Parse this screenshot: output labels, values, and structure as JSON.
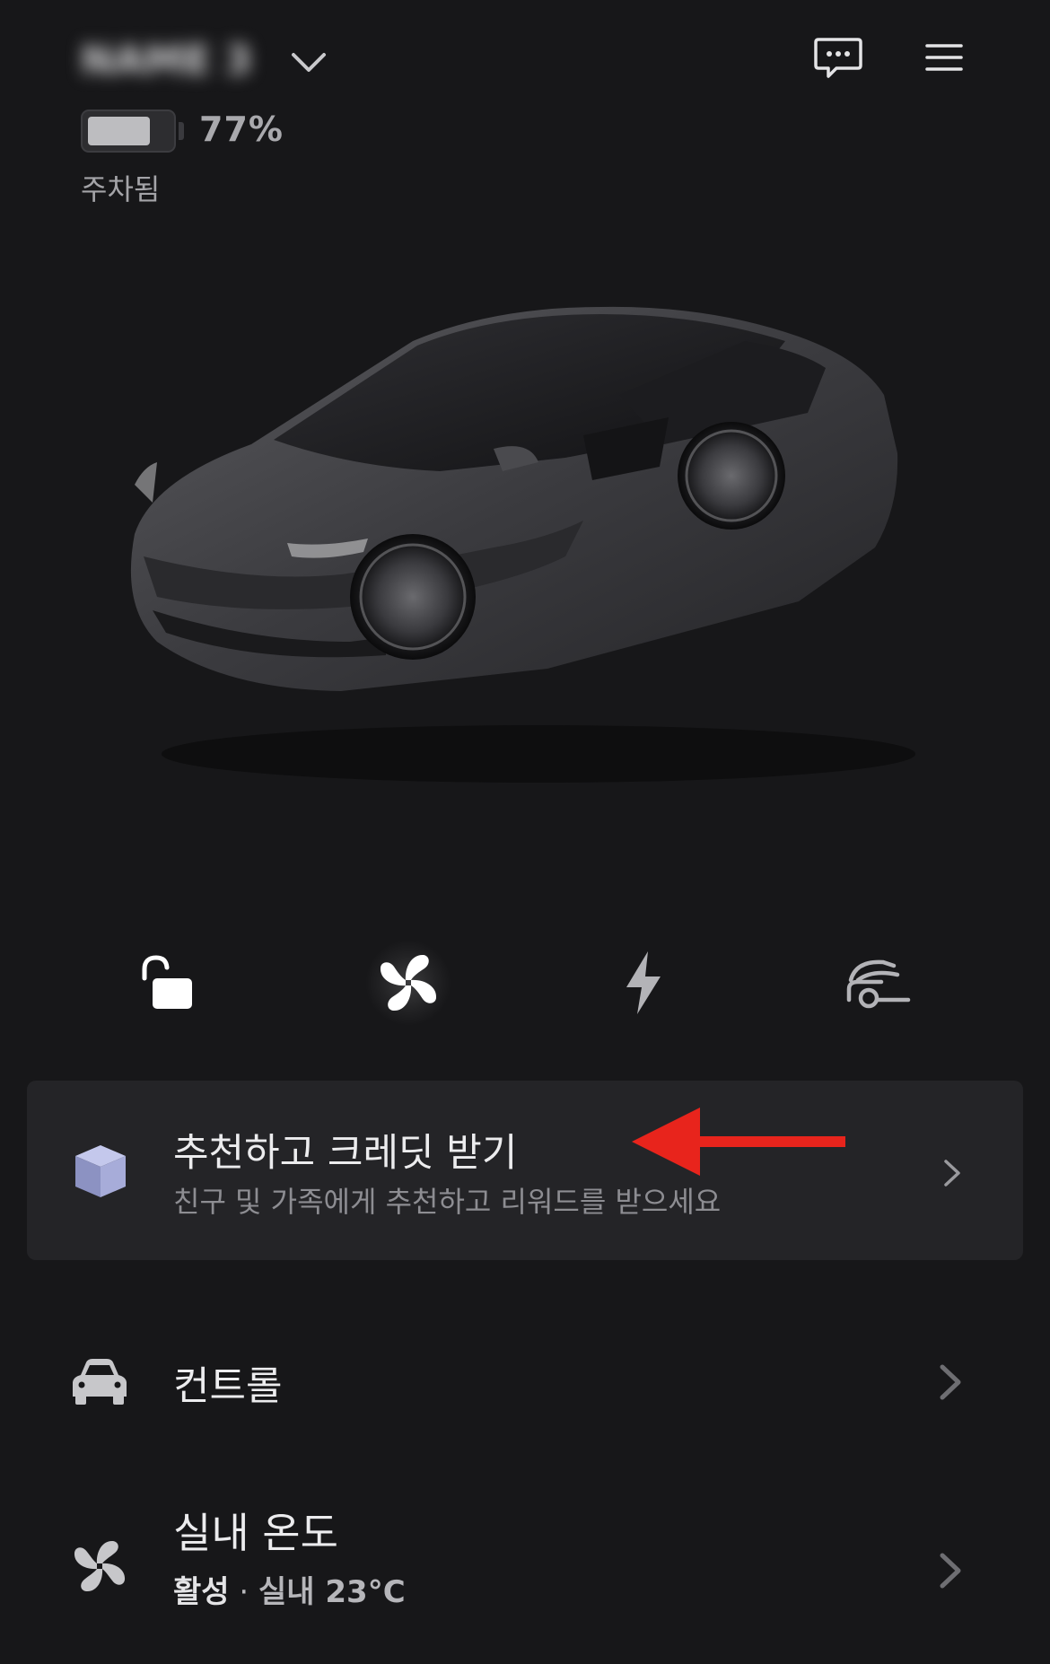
{
  "header": {
    "vehicle_name": "NAME 3",
    "battery_percent_label": "77%",
    "battery_level": 0.77,
    "status": "주차됨",
    "icons": [
      "chevron-down-icon",
      "message-icon",
      "menu-icon"
    ]
  },
  "quick_actions": [
    "unlock-icon",
    "fan-icon",
    "bolt-icon",
    "frunk-icon"
  ],
  "referral": {
    "title": "추천하고 크레딧 받기",
    "subtitle": "친구 및 가족에게 추천하고 리워드를 받으세요",
    "icon": "cube-icon"
  },
  "annotation": {
    "arrow_color": "#e8241c"
  },
  "menu": {
    "controls": {
      "label": "컨트롤",
      "icon": "car-icon"
    },
    "climate": {
      "label": "실내 온도",
      "status_active": "활성",
      "status_sep": " · ",
      "status_temp": "실내 23°C",
      "icon": "fan-icon"
    }
  },
  "colors": {
    "background": "#171719",
    "card": "#242427",
    "text": "#e9e9ea",
    "muted": "#8d8d92"
  }
}
